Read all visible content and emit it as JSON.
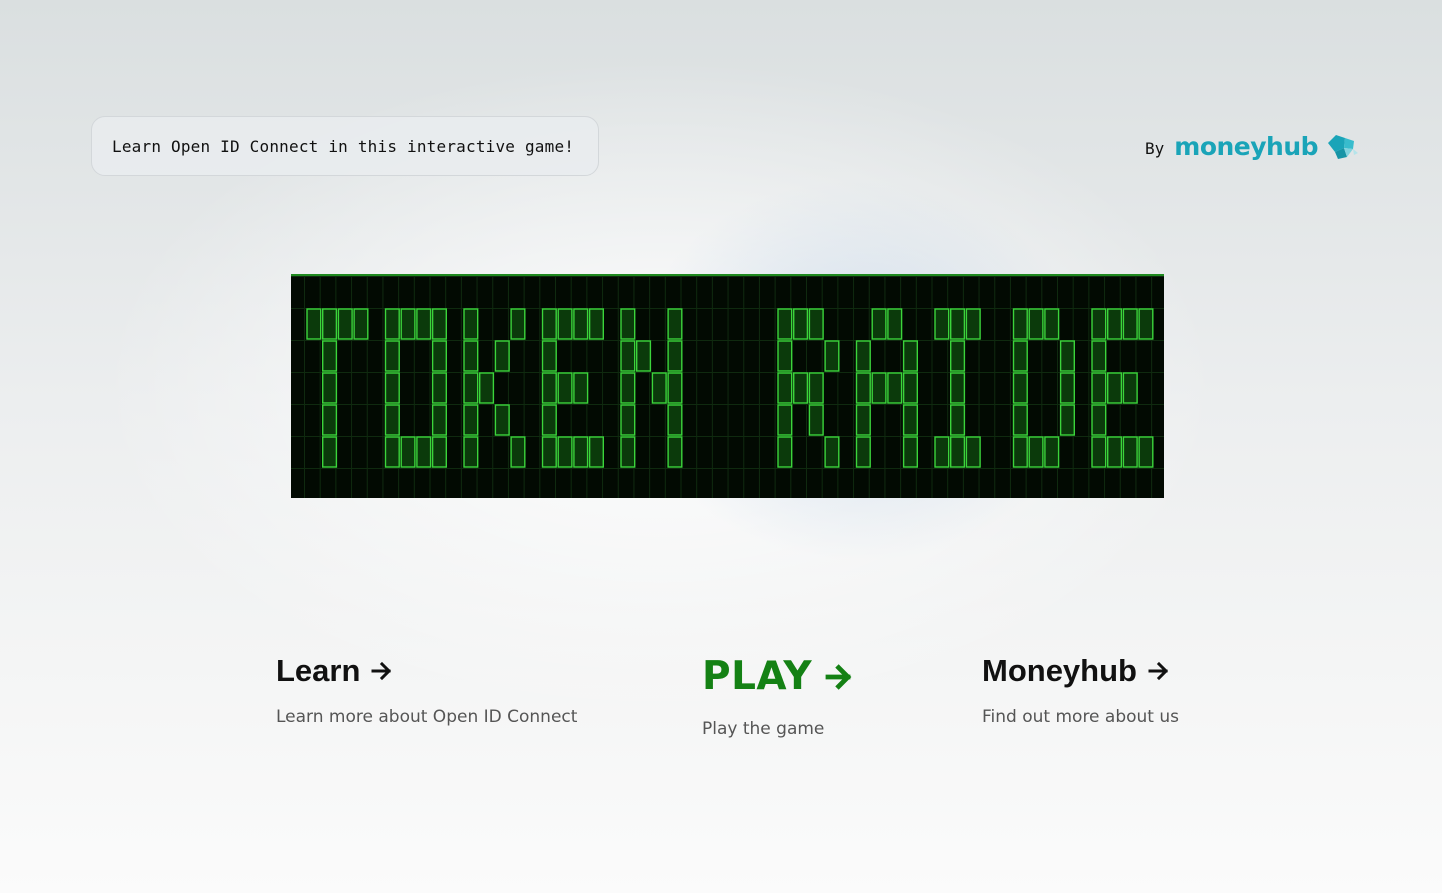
{
  "header": {
    "tagline": "Learn Open ID Connect in this interactive game!",
    "brand_prefix": "By",
    "brand_name": "moneyhub",
    "brand_logo_icon": "moneyhub-hexagon-logo",
    "brand_color": "#1aa4b8"
  },
  "hero": {
    "game_title": "TOKEN RAIDER",
    "title_color": "#3bd43b",
    "background_color": "#020a02"
  },
  "links": {
    "learn": {
      "title": "Learn",
      "description": "Learn more about Open ID Connect",
      "icon": "arrow-right-icon"
    },
    "play": {
      "title": "PLAY",
      "description": "Play the game",
      "icon": "arrow-right-icon",
      "color": "#148114"
    },
    "moneyhub": {
      "title": "Moneyhub",
      "description": "Find out more about us",
      "icon": "arrow-right-icon"
    }
  }
}
